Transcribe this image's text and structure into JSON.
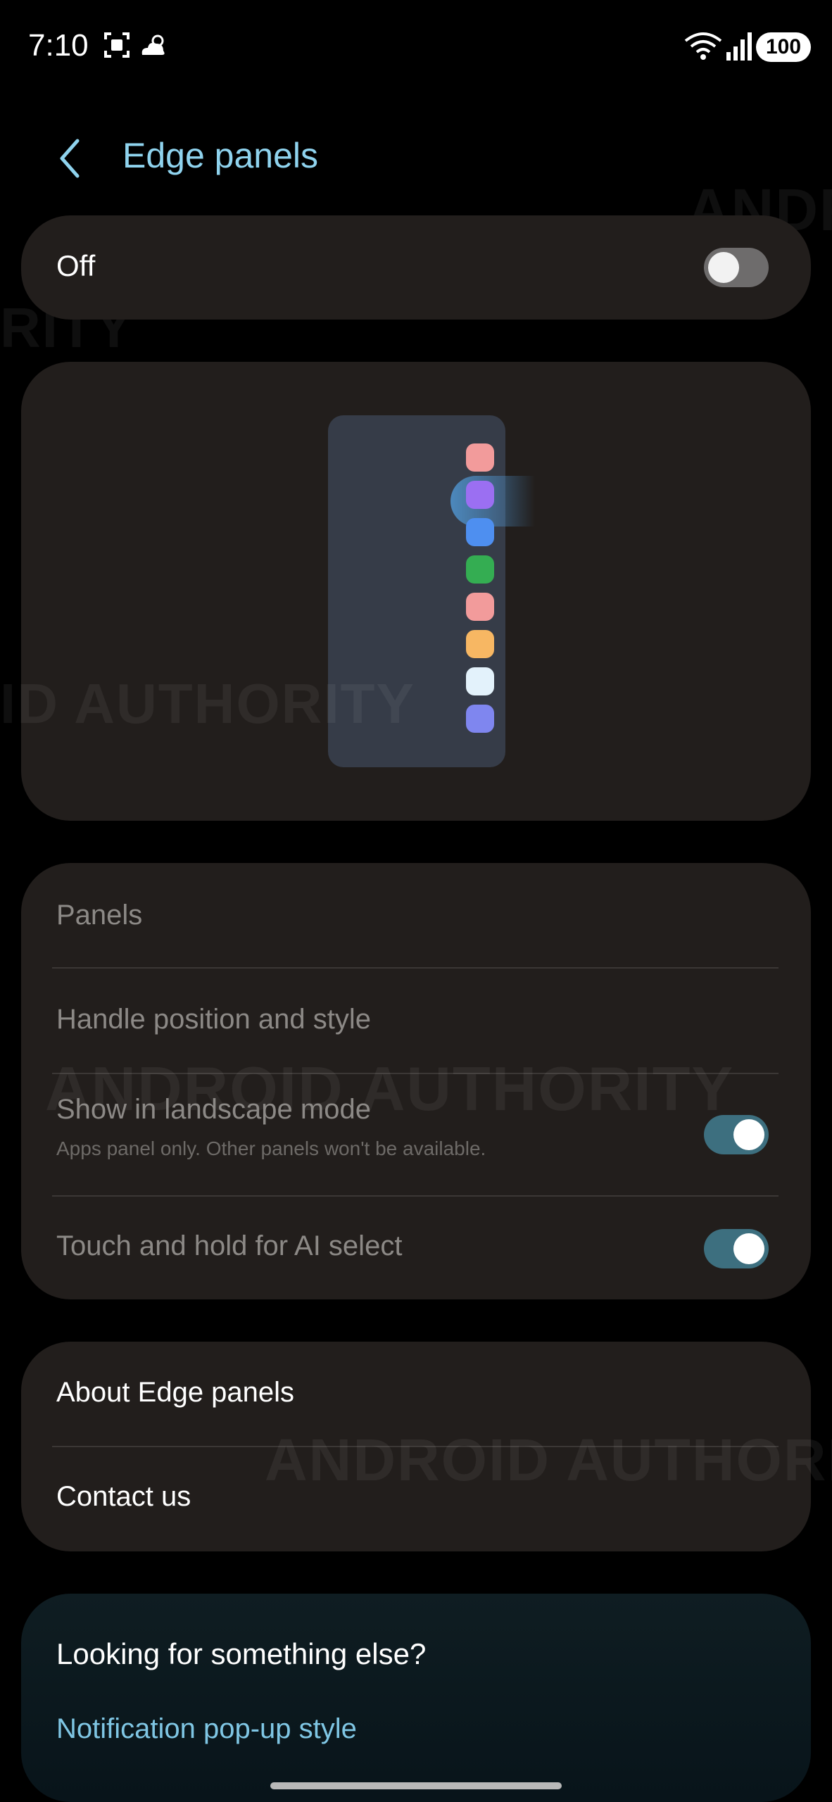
{
  "status_bar": {
    "time": "7:10",
    "battery": "100",
    "icons": [
      "screenshot-icon",
      "weather-cloudy-icon",
      "wifi-icon",
      "signal-icon",
      "battery-icon"
    ]
  },
  "header": {
    "title": "Edge panels",
    "back_icon": "chevron-left-icon",
    "title_color": "#8fd3ee"
  },
  "master_toggle": {
    "label": "Off",
    "state": "off"
  },
  "preview": {
    "app_colors": [
      "#f29b9b",
      "#9b6ff2",
      "#4e8ff0",
      "#34ad52",
      "#f29b9b",
      "#f7b763",
      "#e3f2fb",
      "#7f86ef"
    ]
  },
  "settings": {
    "panels_label": "Panels",
    "handle_label": "Handle position and style",
    "landscape_label": "Show in landscape mode",
    "landscape_sub": "Apps panel only. Other panels won't be available.",
    "landscape_state": "on",
    "ai_label": "Touch and hold for AI select",
    "ai_state": "on"
  },
  "about": {
    "about_label": "About Edge panels",
    "contact_label": "Contact us"
  },
  "suggestions": {
    "title": "Looking for something else?",
    "link": "Notification pop-up style"
  },
  "watermarks": {
    "text1": "ANDR",
    "text2": "RITY",
    "text3": "ID AUTHORITY",
    "text4": "ANDROID AUTHORITY",
    "text5": "ANDROID AUTHORITY"
  },
  "colors": {
    "card_bg": "#221e1c",
    "toggle_on": "#3d6f7f",
    "toggle_off": "#6e6c6c",
    "link": "#7fc6e4"
  }
}
